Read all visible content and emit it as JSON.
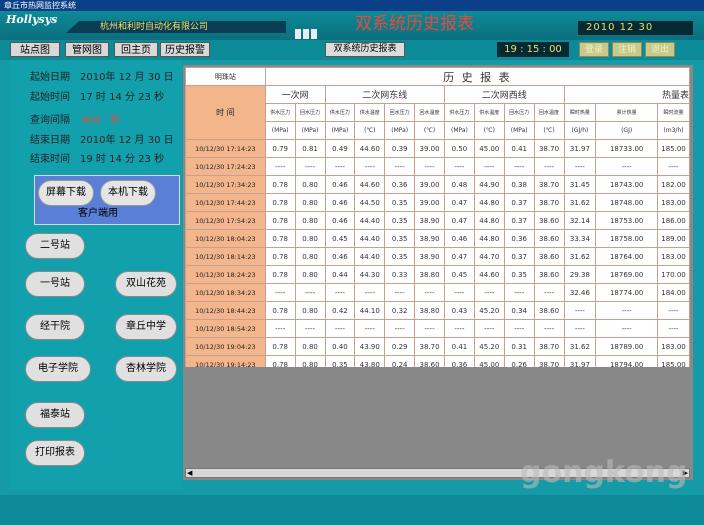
{
  "window": {
    "title": "章丘市热网监控系统"
  },
  "banner": {
    "logo": "Hollysys",
    "company": "杭州和利时自动化有限公司",
    "title": "双系统历史报表",
    "date": "2010  12  30"
  },
  "toolbar": {
    "nav": [
      "站点图",
      "管网图",
      "回主页",
      "历史报警"
    ],
    "system_report": "双系统历史报表",
    "clock": "19 : 15 : 00",
    "actions": [
      "登录",
      "注销",
      "退出"
    ]
  },
  "query": {
    "start_date_label": "起始日期",
    "start_date": "2010年 12 月 30 日",
    "start_time_label": "起始时间",
    "start_time": "17  时 14 分 23 秒",
    "interval_label": "查询间隔",
    "interval_value": "600",
    "interval_unit": "秒",
    "end_date_label": "结束日期",
    "end_date": "2010年 12 月 30 日",
    "end_time_label": "结束时间",
    "end_time": "19  时 14 分 23 秒"
  },
  "download": {
    "screen": "屏幕下载",
    "local": "本机下载",
    "client": "客户端用"
  },
  "stations": [
    "二号站",
    "一号站",
    "双山花苑",
    "经干院",
    "章丘中学",
    "电子学院",
    "杏林学院",
    "福泰站"
  ],
  "print_button": "打印报表",
  "table": {
    "station": "明珠站",
    "title": "历 史 报 表",
    "time_label": "时  间",
    "groups": [
      "一次网",
      "二次网东线",
      "二次网西线",
      "热量表"
    ],
    "subheaders": [
      "供水压力",
      "回水压力",
      "供水压力",
      "供水温度",
      "回水压力",
      "回水温度",
      "供水压力",
      "供水温度",
      "回水压力",
      "回水温度",
      "瞬时热量",
      "累计热量",
      "瞬时流量"
    ],
    "units": [
      "(MPa)",
      "(MPa)",
      "(MPa)",
      "(℃)",
      "(MPa)",
      "(℃)",
      "(MPa)",
      "(℃)",
      "(MPa)",
      "(℃)",
      "(GJ/h)",
      "(GJ)",
      "(m3/h)"
    ],
    "rows": [
      [
        "10/12/30 17:14:23",
        "0.79",
        "0.81",
        "0.49",
        "44.60",
        "0.39",
        "39.00",
        "0.50",
        "45.00",
        "0.41",
        "38.70",
        "31.97",
        "18733.00",
        "185.00"
      ],
      [
        "10/12/30 17:24:23",
        "----",
        "----",
        "----",
        "----",
        "----",
        "----",
        "----",
        "----",
        "----",
        "----",
        "----",
        "----",
        "----"
      ],
      [
        "10/12/30 17:34:23",
        "0.78",
        "0.80",
        "0.46",
        "44.60",
        "0.36",
        "39.00",
        "0.48",
        "44.90",
        "0.38",
        "38.70",
        "31.45",
        "18743.00",
        "182.00"
      ],
      [
        "10/12/30 17:44:23",
        "0.78",
        "0.80",
        "0.46",
        "44.50",
        "0.35",
        "39.00",
        "0.47",
        "44.80",
        "0.37",
        "38.70",
        "31.62",
        "18748.00",
        "183.00"
      ],
      [
        "10/12/30 17:54:23",
        "0.78",
        "0.80",
        "0.46",
        "44.40",
        "0.35",
        "38.90",
        "0.47",
        "44.80",
        "0.37",
        "38.60",
        "32.14",
        "18753.00",
        "186.00"
      ],
      [
        "10/12/30 18:04:23",
        "0.78",
        "0.80",
        "0.45",
        "44.40",
        "0.35",
        "38.90",
        "0.46",
        "44.80",
        "0.36",
        "38.60",
        "33.34",
        "18758.00",
        "189.00"
      ],
      [
        "10/12/30 18:14:23",
        "0.78",
        "0.80",
        "0.46",
        "44.40",
        "0.35",
        "38.90",
        "0.47",
        "44.70",
        "0.37",
        "38.60",
        "31.62",
        "18764.00",
        "183.00"
      ],
      [
        "10/12/30 18:24:23",
        "0.78",
        "0.80",
        "0.44",
        "44.30",
        "0.33",
        "38.80",
        "0.45",
        "44.60",
        "0.35",
        "38.60",
        "29.38",
        "18769.00",
        "170.00"
      ],
      [
        "10/12/30 18:34:23",
        "----",
        "----",
        "----",
        "----",
        "----",
        "----",
        "----",
        "----",
        "----",
        "----",
        "32.46",
        "18774.00",
        "184.00"
      ],
      [
        "10/12/30 18:44:23",
        "0.78",
        "0.80",
        "0.42",
        "44.10",
        "0.32",
        "38.80",
        "0.43",
        "45.20",
        "0.34",
        "38.60",
        "----",
        "----",
        "----"
      ],
      [
        "10/12/30 18:54:23",
        "----",
        "----",
        "----",
        "----",
        "----",
        "----",
        "----",
        "----",
        "----",
        "----",
        "----",
        "----",
        "----"
      ],
      [
        "10/12/30 19:04:23",
        "0.78",
        "0.80",
        "0.40",
        "43.90",
        "0.29",
        "38.70",
        "0.41",
        "45.20",
        "0.31",
        "38.70",
        "31.62",
        "18789.00",
        "183.00"
      ],
      [
        "10/12/30 19:14:23",
        "0.78",
        "0.80",
        "0.35",
        "43.80",
        "0.24",
        "38.60",
        "0.36",
        "45.00",
        "0.26",
        "38.70",
        "31.97",
        "18794.00",
        "185.00"
      ]
    ]
  },
  "watermark": "gongkong"
}
